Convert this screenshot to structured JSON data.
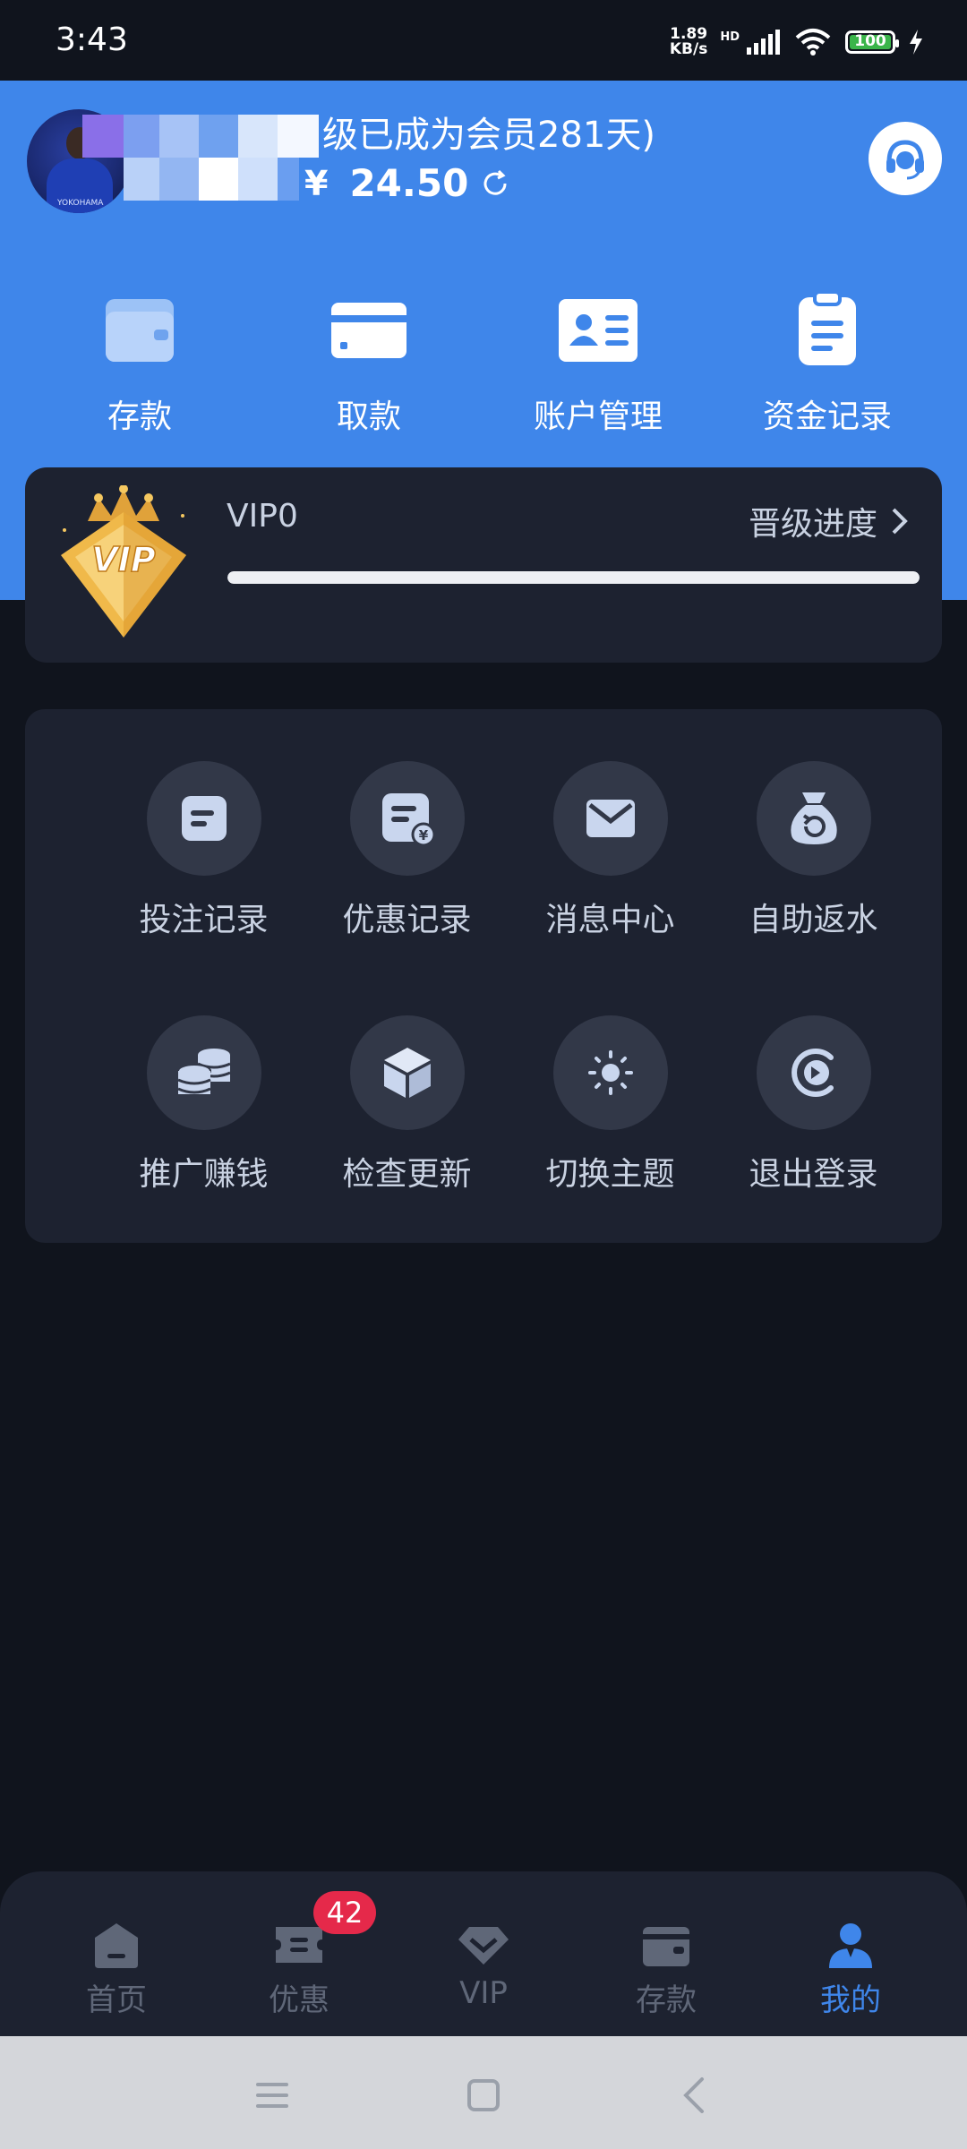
{
  "status_bar": {
    "time": "3:43",
    "net_speed_value": "1.89",
    "net_speed_unit": "KB/s",
    "hd_label": "HD",
    "battery": "100",
    "icons": [
      "signal-icon",
      "wifi-icon",
      "battery-icon",
      "charging-icon"
    ]
  },
  "profile": {
    "username_suffix": "级已成为会员281天)",
    "currency": "¥",
    "balance": "24.50",
    "support_icon": "headset-icon"
  },
  "quick_actions": [
    {
      "label": "存款",
      "icon": "wallet-icon"
    },
    {
      "label": "取款",
      "icon": "card-icon"
    },
    {
      "label": "账户管理",
      "icon": "id-card-icon"
    },
    {
      "label": "资金记录",
      "icon": "clipboard-icon"
    }
  ],
  "vip": {
    "level": "VIP0",
    "progress_label": "晋级进度",
    "badge_text": "VIP",
    "progress": 1.0
  },
  "menu": [
    {
      "label": "投注记录",
      "icon": "bet-record-icon"
    },
    {
      "label": "优惠记录",
      "icon": "promo-record-icon"
    },
    {
      "label": "消息中心",
      "icon": "mail-icon"
    },
    {
      "label": "自助返水",
      "icon": "money-bag-icon"
    },
    {
      "label": "推广赚钱",
      "icon": "coins-icon"
    },
    {
      "label": "检查更新",
      "icon": "box-icon"
    },
    {
      "label": "切换主题",
      "icon": "sun-icon"
    },
    {
      "label": "退出登录",
      "icon": "logout-icon"
    }
  ],
  "tabbar": {
    "tabs": [
      {
        "label": "首页",
        "icon": "home-icon"
      },
      {
        "label": "优惠",
        "icon": "ticket-icon",
        "badge": "42"
      },
      {
        "label": "VIP",
        "icon": "diamond-icon"
      },
      {
        "label": "存款",
        "icon": "wallet-icon"
      },
      {
        "label": "我的",
        "icon": "user-icon"
      }
    ],
    "active_index": 4
  },
  "colors": {
    "accent": "#3f86ea",
    "background": "#10141d",
    "card": "#1d2230",
    "badge": "#e5294a"
  }
}
